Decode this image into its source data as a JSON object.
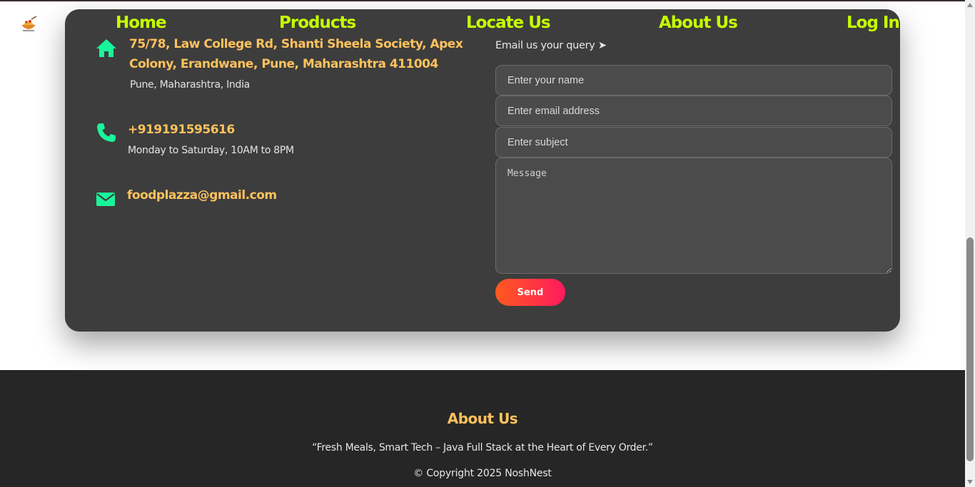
{
  "nav": {
    "items": [
      {
        "label": "Home"
      },
      {
        "label": "Products"
      },
      {
        "label": "Locate Us"
      },
      {
        "label": "About Us"
      },
      {
        "label": "Log In"
      }
    ]
  },
  "contact": {
    "address": {
      "line1": "75/78, Law College Rd, Shanti Sheela Society, Apex",
      "line2": "Colony, Erandwane, Pune, Maharashtra 411004",
      "sub": "Pune, Maharashtra, India",
      "icon": "home-icon"
    },
    "phone": {
      "number": "+919191595616",
      "hours": "Monday to Saturday, 10AM to 8PM",
      "icon": "phone-icon"
    },
    "email": {
      "address": "foodplazza@gmail.com",
      "icon": "mail-icon"
    }
  },
  "form": {
    "title": "Email us your query ➤",
    "name_placeholder": "Enter your name",
    "email_placeholder": "Enter email address",
    "subject_placeholder": "Enter subject",
    "message_placeholder": "Message",
    "send_label": "Send"
  },
  "footer": {
    "title": "About Us",
    "quote": "“Fresh Meals, Smart Tech – Java Full Stack at the Heart of Every Order.”",
    "copyright": "© Copyright 2025 NoshNest"
  },
  "colors": {
    "nav": "#c6ff00",
    "accent": "#ffc25c",
    "icon": "#19f59a",
    "card_bg": "#3d3d3d",
    "footer_bg": "#262626",
    "send_gradient_start": "#ff5a1f",
    "send_gradient_end": "#ff1a5e"
  }
}
